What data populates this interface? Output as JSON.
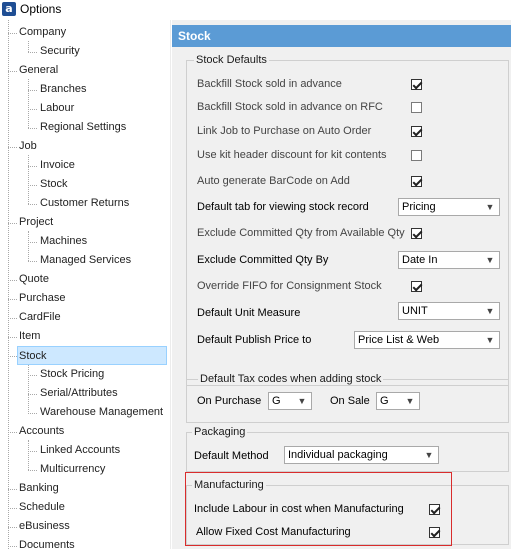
{
  "window": {
    "title": "Options",
    "icon": "app-logo-icon"
  },
  "tree": {
    "items": [
      {
        "label": "Company",
        "level": 0
      },
      {
        "label": "Security",
        "level": 1
      },
      {
        "label": "General",
        "level": 0
      },
      {
        "label": "Branches",
        "level": 1
      },
      {
        "label": "Labour",
        "level": 1
      },
      {
        "label": "Regional Settings",
        "level": 1
      },
      {
        "label": "Job",
        "level": 0
      },
      {
        "label": "Invoice",
        "level": 1
      },
      {
        "label": "Stock",
        "level": 1
      },
      {
        "label": "Customer Returns",
        "level": 1
      },
      {
        "label": "Project",
        "level": 0
      },
      {
        "label": "Machines",
        "level": 1
      },
      {
        "label": "Managed Services",
        "level": 1
      },
      {
        "label": "Quote",
        "level": 0
      },
      {
        "label": "Purchase",
        "level": 0
      },
      {
        "label": "CardFile",
        "level": 0
      },
      {
        "label": "Item",
        "level": 0
      },
      {
        "label": "Stock",
        "level": 0,
        "selected": true
      },
      {
        "label": "Stock Pricing",
        "level": 1
      },
      {
        "label": "Serial/Attributes",
        "level": 1
      },
      {
        "label": "Warehouse Management",
        "level": 1
      },
      {
        "label": "Accounts",
        "level": 0
      },
      {
        "label": "Linked Accounts",
        "level": 1
      },
      {
        "label": "Multicurrency",
        "level": 1
      },
      {
        "label": "Banking",
        "level": 0
      },
      {
        "label": "Schedule",
        "level": 0
      },
      {
        "label": "eBusiness",
        "level": 0
      },
      {
        "label": "Documents",
        "level": 0
      }
    ]
  },
  "panel": {
    "header": "Stock",
    "stock_defaults": {
      "title": "Stock Defaults",
      "backfill": {
        "label": "Backfill Stock sold in advance",
        "checked": true
      },
      "backfill_rfc": {
        "label": "Backfill Stock sold in advance on RFC",
        "checked": false
      },
      "link_job": {
        "label": "Link Job to Purchase on Auto Order",
        "checked": true
      },
      "kit_header": {
        "label": "Use kit header discount for kit contents",
        "checked": false
      },
      "auto_barcode": {
        "label": "Auto generate BarCode on Add",
        "checked": true
      },
      "default_tab": {
        "label": "Default tab for viewing stock record",
        "value": "Pricing"
      },
      "exclude_committed": {
        "label": "Exclude Committed Qty from Available Qty",
        "checked": true
      },
      "exclude_by": {
        "label": "Exclude Committed Qty By",
        "value": "Date In"
      },
      "override_fifo": {
        "label": "Override FIFO for Consignment Stock",
        "checked": true
      },
      "unit_measure": {
        "label": "Default Unit Measure",
        "value": "UNIT"
      },
      "publish_price": {
        "label": "Default Publish Price to",
        "value": "Price List & Web"
      }
    },
    "tax_codes": {
      "title": "Default Tax codes when adding stock",
      "on_purchase": {
        "label": "On Purchase",
        "value": "G"
      },
      "on_sale": {
        "label": "On Sale",
        "value": "G"
      }
    },
    "packaging": {
      "title": "Packaging",
      "default_method": {
        "label": "Default Method",
        "value": "Individual packaging"
      }
    },
    "manufacturing": {
      "title": "Manufacturing",
      "include_labour": {
        "label": "Include Labour in cost when Manufacturing",
        "checked": true
      },
      "fixed_cost": {
        "label": "Allow Fixed Cost Manufacturing",
        "checked": true
      }
    }
  },
  "colors": {
    "header": "#5b9bd5",
    "selection": "#cde8ff",
    "highlight": "#d92c2c"
  }
}
